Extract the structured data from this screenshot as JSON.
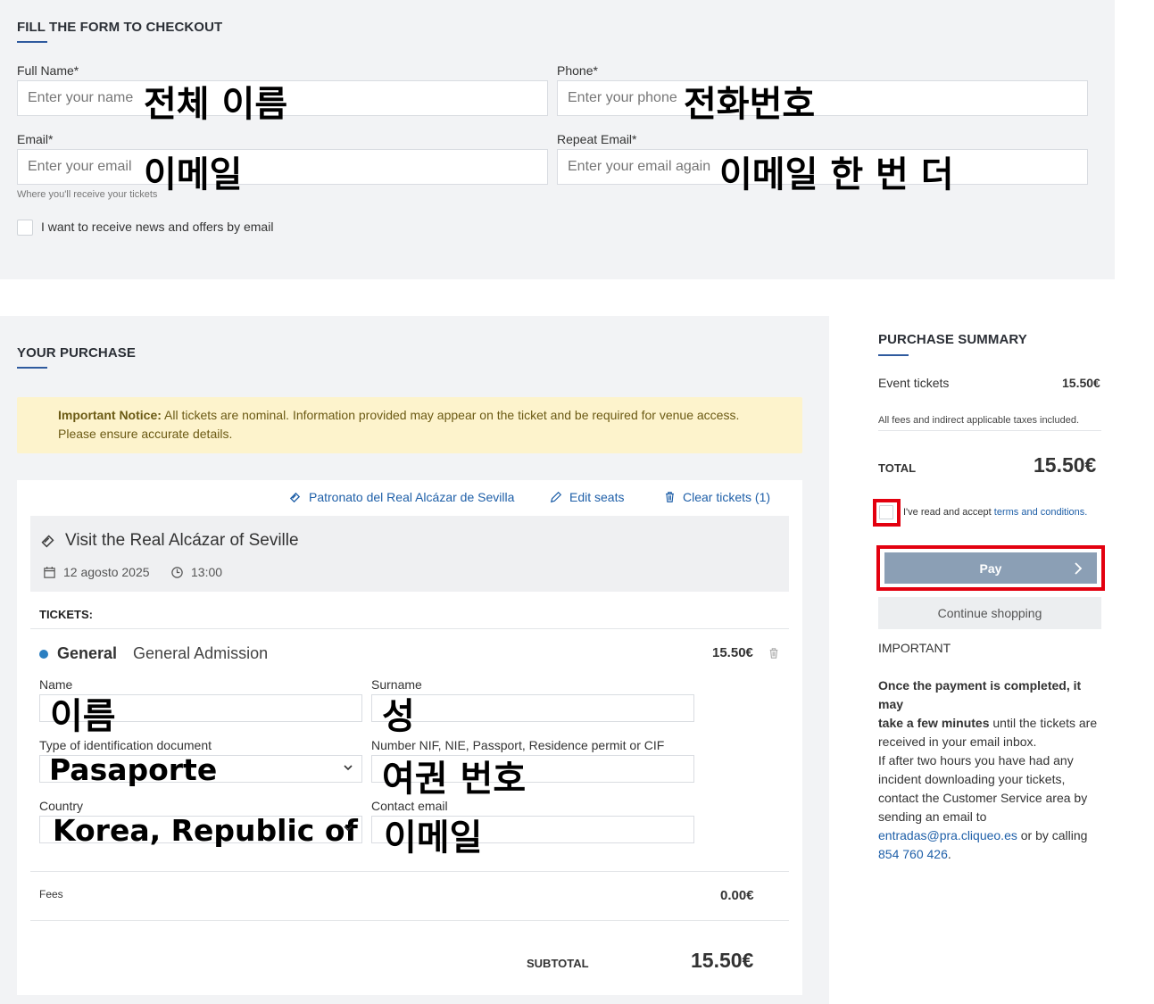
{
  "form": {
    "title": "FILL THE FORM TO CHECKOUT",
    "full_name_label": "Full Name*",
    "full_name_placeholder": "Enter your name",
    "full_name_annot": "전체 이름",
    "phone_label": "Phone*",
    "phone_placeholder": "Enter your phone",
    "phone_annot": "전화번호",
    "email_label": "Email*",
    "email_placeholder": "Enter your email",
    "email_annot": "이메일",
    "email_hint": "Where you'll receive your tickets",
    "repeat_email_label": "Repeat Email*",
    "repeat_email_placeholder": "Enter your email again",
    "repeat_email_annot": "이메일 한 번 더",
    "newsletter_label": "I want to receive news and offers by email"
  },
  "purchase": {
    "title": "YOUR PURCHASE",
    "notice_bold": "Important Notice:",
    "notice_text": " All tickets are nominal. Information provided may appear on the ticket and be required for venue access. Please ensure accurate details.",
    "venue_link": "Patronato del Real Alcázar de Sevilla",
    "edit_seats": "Edit seats",
    "clear_tickets": "Clear tickets (1)",
    "event_title": "Visit the Real Alcázar of Seville",
    "event_date": "12 agosto 2025",
    "event_time": "13:00",
    "tickets_label": "TICKETS:",
    "ticket_type": "General",
    "ticket_desc": "General Admission",
    "ticket_price": "15.50€",
    "name_label": "Name",
    "name_annot": "이름",
    "surname_label": "Surname",
    "surname_annot": "성",
    "doc_type_label": "Type of identification document",
    "doc_type_value": "Pasaporte",
    "doc_number_label": "Number NIF, NIE, Passport, Residence permit or CIF",
    "doc_number_annot": "여권 번호",
    "country_label": "Country",
    "country_value": "Korea, Republic of",
    "contact_email_label": "Contact email",
    "contact_email_annot": "이메일",
    "fees_label": "Fees",
    "fees_value": "0.00€",
    "subtotal_label": "SUBTOTAL",
    "subtotal_value": "15.50€"
  },
  "summary": {
    "title": "PURCHASE SUMMARY",
    "event_tickets_label": "Event tickets",
    "event_tickets_value": "15.50€",
    "taxes_note": "All fees and indirect applicable taxes included.",
    "total_label": "TOTAL",
    "total_value": "15.50€",
    "terms_prefix": "I've read and accept ",
    "terms_link": "terms and conditions.",
    "pay_label": "Pay",
    "continue_label": "Continue shopping",
    "important_label": "IMPORTANT",
    "para1_bold1": "Once the payment is completed, it may",
    "para1_bold2": "take a few minutes",
    "para1_rest1": " until the tickets are",
    "para1_rest2": "received in your email inbox.",
    "para2_line1": "If after two hours you have had any",
    "para2_line2": "incident downloading your tickets,",
    "para2_line3": "contact the Customer Service area by",
    "para2_line4": "sending an email to",
    "support_email": "entradas@pra.cliqueo.es",
    "or_calling": " or by calling",
    "support_phone": "854 760 426",
    "period": "."
  },
  "colors": {
    "accent": "#2f5a9e",
    "highlight_red": "#e3000f",
    "pay_button": "#8b9fb5",
    "notice_bg": "#fdf3cc",
    "ticket_dot": "#2b7fc1"
  }
}
